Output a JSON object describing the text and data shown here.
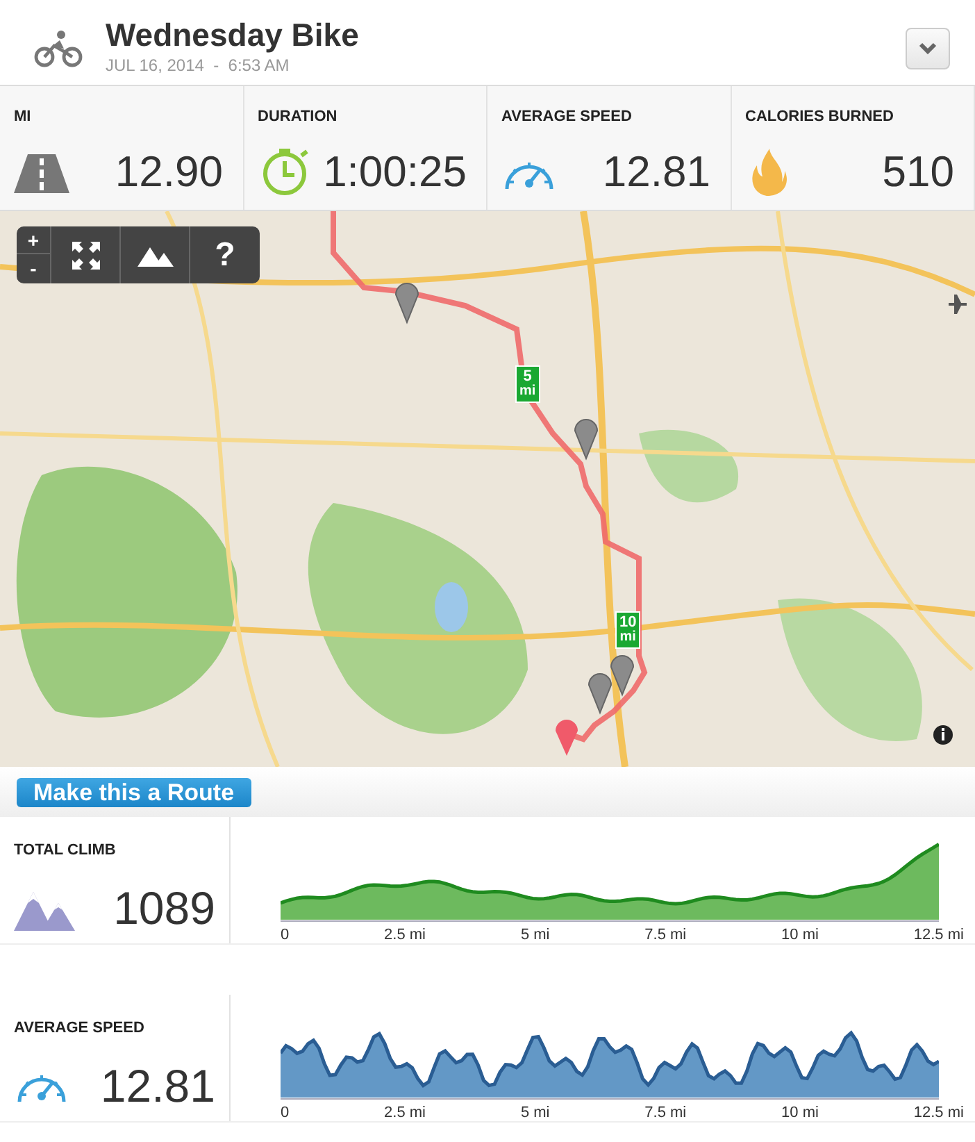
{
  "activity": {
    "title": "Wednesday Bike",
    "date": "JUL 16, 2014  -  6:53 AM"
  },
  "stats": [
    {
      "kind": "distance",
      "label": "MI",
      "value": "12.90"
    },
    {
      "kind": "duration",
      "label": "DURATION",
      "value": "1:00:25"
    },
    {
      "kind": "speed",
      "label": "AVERAGE SPEED",
      "value": "12.81"
    },
    {
      "kind": "calories",
      "label": "CALORIES BURNED",
      "value": "510"
    }
  ],
  "map": {
    "kind": "picture",
    "zoom_in": "+",
    "zoom_out": "-",
    "help": "?",
    "mile_markers": [
      {
        "number": "5",
        "unit": "mi"
      },
      {
        "number": "10",
        "unit": "mi"
      }
    ]
  },
  "route_button": "Make this a Route",
  "panels": [
    {
      "kind": "elevation",
      "label": "TOTAL CLIMB",
      "value": "1089",
      "x_tick_labels": [
        "0",
        "2.5 mi",
        "5 mi",
        "7.5 mi",
        "10 mi",
        "12.5 mi"
      ]
    },
    {
      "kind": "speed",
      "label": "AVERAGE SPEED",
      "value": "12.81",
      "x_tick_labels": [
        "0",
        "2.5 mi",
        "5 mi",
        "7.5 mi",
        "10 mi",
        "12.5 mi"
      ]
    }
  ]
}
